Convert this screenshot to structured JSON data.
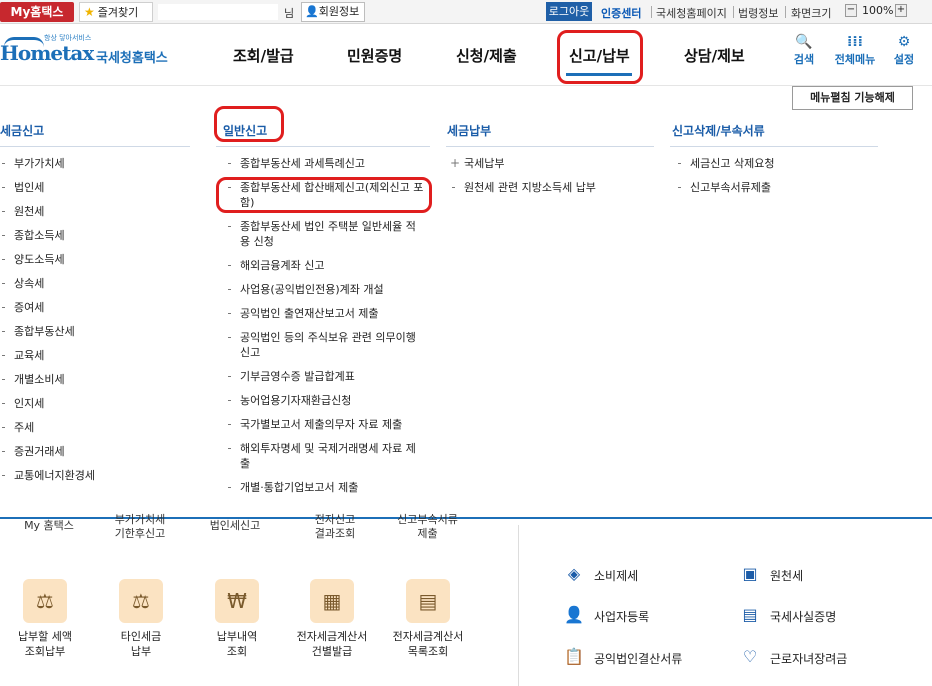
{
  "topbar": {
    "my_label": "My홈택스",
    "fav_label": "즐겨찾기",
    "user_suffix": "님",
    "member_label": "회원정보",
    "logout_label": "로그아웃",
    "cert_label": "인증센터",
    "links": [
      "국세청홈페이지",
      "법령정보",
      "화면크기"
    ],
    "zoom": "100%",
    "zoom_minus": "−",
    "zoom_plus": "+"
  },
  "logo": {
    "small": "항상 닿아서비스",
    "main": "Hometax",
    "kr": "국세청홈택스"
  },
  "nav": {
    "items": [
      "조회/발급",
      "민원증명",
      "신청/제출",
      "신고/납부",
      "상담/제보"
    ],
    "active": "신고/납부",
    "tools": [
      {
        "icon": "search-icon",
        "label": "검색"
      },
      {
        "icon": "grid-icon",
        "label": "전체메뉴"
      },
      {
        "icon": "gear-icon",
        "label": "설정"
      }
    ]
  },
  "menu": {
    "unfix_label": "메뉴펼침 기능해제",
    "columns": [
      {
        "title": "세금신고",
        "items": [
          "부가가치세",
          "법인세",
          "원천세",
          "종합소득세",
          "양도소득세",
          "상속세",
          "증여세",
          "종합부동산세",
          "교육세",
          "개별소비세",
          "인지세",
          "주세",
          "증권거래세",
          "교통에너지환경세"
        ]
      },
      {
        "title": "일반신고",
        "items": [
          "종합부동산세 과세특례신고",
          "종합부동산세 합산배제신고(제외신고 포함)",
          "종합부동산세 법인 주택분 일반세율 적용 신청",
          "해외금융계좌 신고",
          "사업용(공익법인전용)계좌 개설",
          "공익법인 출연재산보고서 제출",
          "공익법인 등의 주식보유 관련 의무이행 신고",
          "기부금영수증 발급합계표",
          "농어업용기자재환급신청",
          "국가별보고서 제출의무자 자료 제출",
          "해외투자명세 및 국제거래명세 자료 제출",
          "개별·통합기업보고서 제출"
        ]
      },
      {
        "title": "세금납부",
        "items": [
          "국세납부",
          "원천세 관련 지방소득세 납부"
        ]
      },
      {
        "title": "신고삭제/부속서류",
        "items": [
          "세금신고 삭제요청",
          "신고부속서류제출"
        ]
      }
    ]
  },
  "lower": {
    "cut_labels": [
      "My 홈택스",
      "부가가치세\n기한후신고",
      "법인세신고",
      "전자신고\n결과조회",
      "신고부속서류\n제출"
    ],
    "tiles": [
      {
        "icon": "tax-pot-icon",
        "label": "납부할 세액\n조회납부"
      },
      {
        "icon": "tax-pot-icon",
        "label": "타인세금\n납부"
      },
      {
        "icon": "payment-history-icon",
        "label": "납부내역\n조회"
      },
      {
        "icon": "invoice-icon",
        "label": "전자세금계산서\n건별발급"
      },
      {
        "icon": "invoice-list-icon",
        "label": "전자세금계산서\n목록조회"
      }
    ],
    "services_left": [
      {
        "icon": "diamond-icon",
        "label": "소비제세"
      },
      {
        "icon": "person-icon",
        "label": "사업자등록"
      },
      {
        "icon": "clipboard-icon",
        "label": "공익법인결산서류"
      }
    ],
    "services_right": [
      {
        "icon": "salary-icon",
        "label": "원천세"
      },
      {
        "icon": "document-icon",
        "label": "국세사실증명"
      },
      {
        "icon": "heart-icon",
        "label": "근로자녀장려금"
      }
    ]
  }
}
